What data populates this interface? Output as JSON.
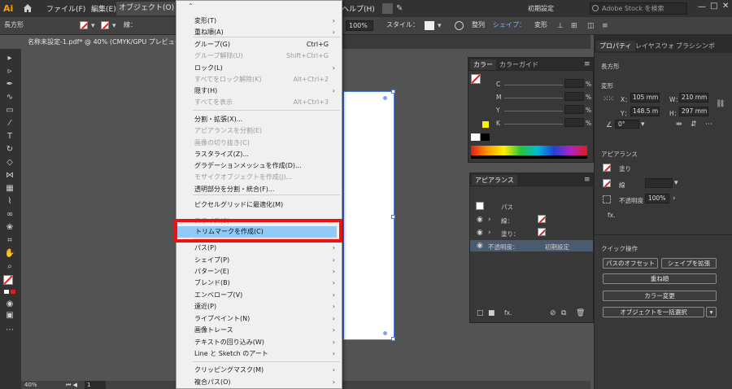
{
  "app_logo": "Ai",
  "menubar": {
    "items": [
      "ファイル(F)",
      "編集(E)",
      "オブジェクト(O)",
      "ヘルプ(H)"
    ],
    "workspace": "初期設定",
    "search_placeholder": "Adobe Stock を検索"
  },
  "controlbar": {
    "shape_label": "長方形",
    "stroke_label": "線：",
    "zoom": "100%",
    "style_label": "スタイル：",
    "align_label": "整列",
    "shape_link": "シェイプ：",
    "transform_label": "変形"
  },
  "document_tab": "名称未設定-1.pdf* @ 40% (CMYK/GPU プレビュー)",
  "statusbar": {
    "zoom": "40%",
    "page": "1"
  },
  "object_menu": {
    "items": [
      {
        "label": "変形(T)",
        "shortcut": "",
        "arrow": true,
        "disabled": false
      },
      {
        "label": "重ね順(A)",
        "shortcut": "",
        "arrow": true,
        "disabled": false
      },
      {
        "label": "グループ(G)",
        "shortcut": "Ctrl+G",
        "arrow": false,
        "disabled": false
      },
      {
        "label": "グループ解除(U)",
        "shortcut": "Shift+Ctrl+G",
        "arrow": false,
        "disabled": true
      },
      {
        "label": "ロック(L)",
        "shortcut": "",
        "arrow": true,
        "disabled": false
      },
      {
        "label": "すべてをロック解除(K)",
        "shortcut": "Alt+Ctrl+2",
        "arrow": false,
        "disabled": true
      },
      {
        "label": "隠す(H)",
        "shortcut": "",
        "arrow": true,
        "disabled": false
      },
      {
        "label": "すべてを表示",
        "shortcut": "Alt+Ctrl+3",
        "arrow": false,
        "disabled": true
      },
      {
        "label": "分割・拡張(X)...",
        "shortcut": "",
        "arrow": false,
        "disabled": false
      },
      {
        "label": "アピアランスを分割(E)",
        "shortcut": "",
        "arrow": false,
        "disabled": true
      },
      {
        "label": "画像の切り抜き(C)",
        "shortcut": "",
        "arrow": false,
        "disabled": true
      },
      {
        "label": "ラスタライズ(Z)...",
        "shortcut": "",
        "arrow": false,
        "disabled": false
      },
      {
        "label": "グラデーションメッシュを作成(D)...",
        "shortcut": "",
        "arrow": false,
        "disabled": false
      },
      {
        "label": "モザイクオブジェクトを作成(J)...",
        "shortcut": "",
        "arrow": false,
        "disabled": true
      },
      {
        "label": "透明部分を分割・統合(F)...",
        "shortcut": "",
        "arrow": false,
        "disabled": false
      },
      {
        "label": "ピクセルグリッドに最適化(M)",
        "shortcut": "",
        "arrow": false,
        "disabled": false
      },
      {
        "label": "スライス(S)",
        "shortcut": "",
        "arrow": true,
        "disabled": true
      },
      {
        "label": "トリムマークを作成(C)",
        "shortcut": "",
        "arrow": false,
        "disabled": false
      },
      {
        "label": "パス(P)",
        "shortcut": "",
        "arrow": true,
        "disabled": false
      },
      {
        "label": "シェイプ(P)",
        "shortcut": "",
        "arrow": true,
        "disabled": false
      },
      {
        "label": "パターン(E)",
        "shortcut": "",
        "arrow": true,
        "disabled": false
      },
      {
        "label": "ブレンド(B)",
        "shortcut": "",
        "arrow": true,
        "disabled": false
      },
      {
        "label": "エンベロープ(V)",
        "shortcut": "",
        "arrow": true,
        "disabled": false
      },
      {
        "label": "遠近(P)",
        "shortcut": "",
        "arrow": true,
        "disabled": false
      },
      {
        "label": "ライブペイント(N)",
        "shortcut": "",
        "arrow": true,
        "disabled": false
      },
      {
        "label": "画像トレース",
        "shortcut": "",
        "arrow": true,
        "disabled": false
      },
      {
        "label": "テキストの回り込み(W)",
        "shortcut": "",
        "arrow": true,
        "disabled": false
      },
      {
        "label": "Line と Sketch のアート",
        "shortcut": "",
        "arrow": true,
        "disabled": false
      },
      {
        "label": "クリッピングマスク(M)",
        "shortcut": "",
        "arrow": true,
        "disabled": false
      },
      {
        "label": "複合パス(O)",
        "shortcut": "",
        "arrow": true,
        "disabled": false
      }
    ]
  },
  "color_panel": {
    "tabs": [
      "カラー",
      "カラーガイド"
    ],
    "channels": [
      "C",
      "M",
      "Y",
      "K"
    ],
    "unit": "%"
  },
  "appearance_panel": {
    "tab": "アピアランス",
    "title": "パス",
    "stroke_label": "線：",
    "fill_label": "塗り：",
    "opacity_label": "不透明度：",
    "opacity_value": "初期設定",
    "fx_label": "fx."
  },
  "right_panel": {
    "tabs": [
      "プロパティ",
      "レイヤ",
      "スウォ",
      "ブラシ",
      "シンボ"
    ],
    "object_type": "長方形",
    "transform_title": "変形",
    "x_label": "X：",
    "x_value": "105 mm",
    "y_label": "Y：",
    "y_value": "148.5 m",
    "w_label": "W：",
    "w_value": "210 mm",
    "h_label": "H：",
    "h_value": "297 mm",
    "angle_value": "0°",
    "appearance_title": "アピアランス",
    "fill_label": "塗り",
    "stroke_label": "線",
    "opacity_label": "不透明度",
    "opacity_value": "100%",
    "fx_label": "fx.",
    "quick_actions_title": "クイック操作",
    "quick_buttons": [
      "パスのオフセット",
      "シェイプを拡張",
      "重ね順",
      "カラー変更",
      "オブジェクトを一括選択"
    ]
  },
  "colors": {
    "accent_highlight": "#91c9f7",
    "callout_red": "#ee1111",
    "ai_orange": "#ff9a00"
  }
}
